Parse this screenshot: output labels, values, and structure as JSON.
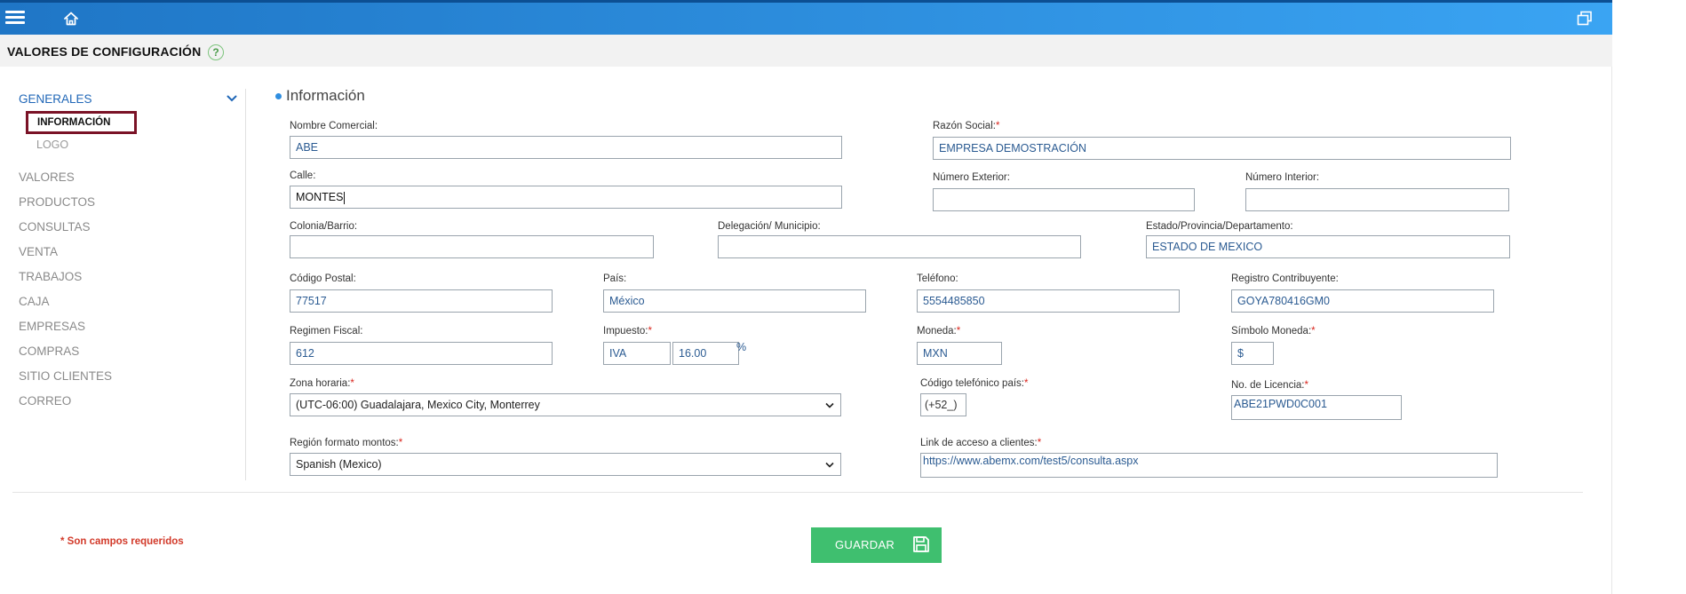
{
  "header": {
    "title": "VALORES DE CONFIGURACIÓN",
    "help_symbol": "?"
  },
  "sidebar": {
    "groups": [
      {
        "label": "GENERALES",
        "active": true
      },
      {
        "label": "VALORES"
      },
      {
        "label": "PRODUCTOS"
      },
      {
        "label": "CONSULTAS"
      },
      {
        "label": "VENTA"
      },
      {
        "label": "TRABAJOS"
      },
      {
        "label": "CAJA"
      },
      {
        "label": "EMPRESAS"
      },
      {
        "label": "COMPRAS"
      },
      {
        "label": "SITIO CLIENTES"
      },
      {
        "label": "CORREO"
      }
    ],
    "subitems": [
      {
        "label": "INFORMACIÓN",
        "selected": true
      },
      {
        "label": "LOGO"
      }
    ]
  },
  "section": {
    "title": "Información"
  },
  "form": {
    "nombre_comercial": {
      "label": "Nombre Comercial:",
      "value": "ABE"
    },
    "razon_social": {
      "label": "Razón Social:",
      "value": "EMPRESA DEMOSTRACIÓN",
      "required": true
    },
    "calle": {
      "label": "Calle:",
      "value": "MONTES"
    },
    "numero_exterior": {
      "label": "Número Exterior:",
      "value": ""
    },
    "numero_interior": {
      "label": "Número Interior:",
      "value": ""
    },
    "colonia": {
      "label": "Colonia/Barrio:",
      "value": ""
    },
    "delegacion": {
      "label": "Delegación/ Municipio:",
      "value": ""
    },
    "estado": {
      "label": "Estado/Provincia/Departamento:",
      "value": "ESTADO DE MEXICO"
    },
    "codigo_postal": {
      "label": "Código Postal:",
      "value": "77517"
    },
    "pais": {
      "label": "País:",
      "value": "México"
    },
    "telefono": {
      "label": "Teléfono:",
      "value": "5554485850"
    },
    "registro_contribuyente": {
      "label": "Registro Contribuyente:",
      "value": "GOYA780416GM0"
    },
    "regimen_fiscal": {
      "label": "Regimen Fiscal:",
      "value": "612"
    },
    "impuesto": {
      "label": "Impuesto:",
      "name": "IVA",
      "rate": "16.00",
      "unit": "%",
      "required": true
    },
    "moneda": {
      "label": "Moneda:",
      "value": "MXN",
      "required": true
    },
    "simbolo_moneda": {
      "label": "Símbolo Moneda:",
      "value": "$",
      "required": true
    },
    "zona_horaria": {
      "label": "Zona horaria:",
      "value": "(UTC-06:00) Guadalajara, Mexico City, Monterrey",
      "required": true
    },
    "codigo_telefonico": {
      "label": "Código telefónico país:",
      "value": "(+52_)",
      "required": true
    },
    "licencia": {
      "label": "No. de Licencia:",
      "value": "ABE21PWD0C001",
      "required": true
    },
    "region_formato": {
      "label": "Región formato montos:",
      "value": "Spanish (Mexico)",
      "required": true
    },
    "link_acceso": {
      "label": "Link de acceso a clientes:",
      "value": "https://www.abemx.com/test5/consulta.aspx",
      "required": true
    }
  },
  "footer": {
    "required_note": "* Son campos requeridos",
    "save_label": "GUARDAR"
  },
  "icons": {
    "menu": "hamburger-menu-icon",
    "home": "home-icon",
    "restore": "window-restore-icon",
    "save": "floppy-disk-icon"
  },
  "colors": {
    "topbar_start": "#1f76c6",
    "topbar_end": "#3aa4f3",
    "active_nav": "#2067b7",
    "selected_border": "#7a1226",
    "save_button": "#3fbf6f",
    "required": "#d9251d"
  }
}
